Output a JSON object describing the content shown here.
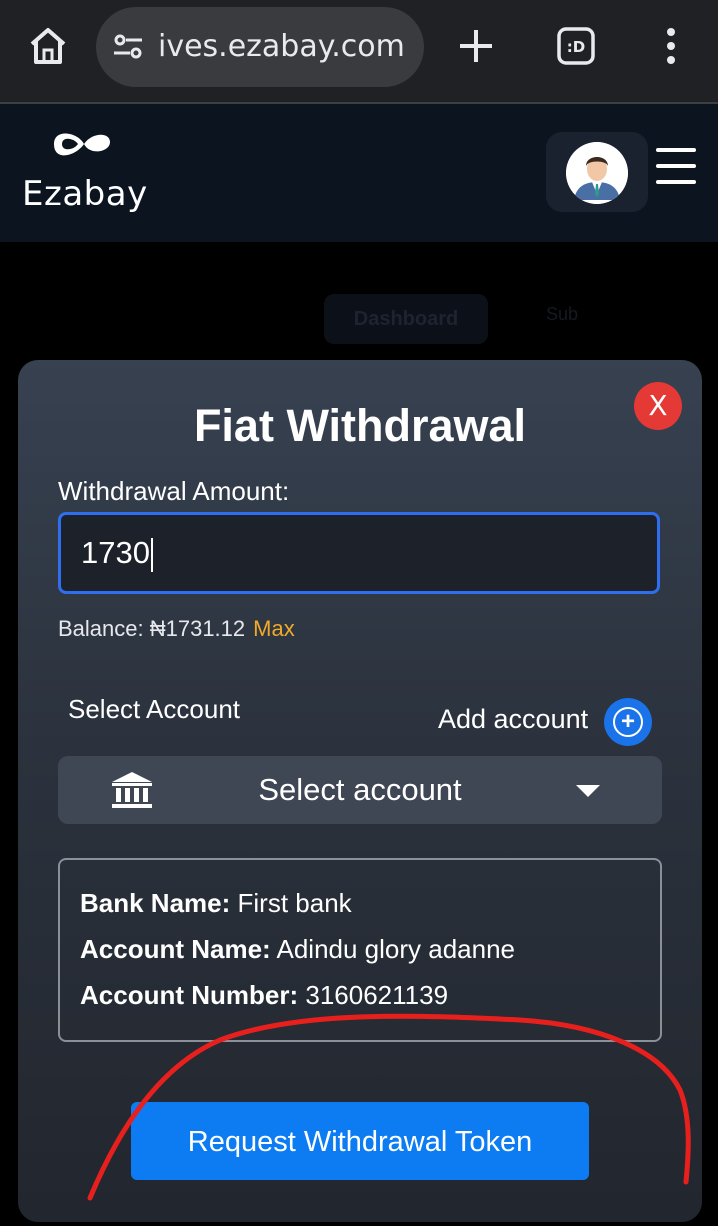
{
  "browser": {
    "url": "ives.ezabay.com",
    "tabs_count": ":D"
  },
  "site": {
    "brand": "Ezabay",
    "background_nav": {
      "dashboard": "Dashboard",
      "other": "Sub"
    }
  },
  "modal": {
    "close_label": "X",
    "title": "Fiat Withdrawal",
    "amount_label": "Withdrawal Amount:",
    "amount_value": "1730",
    "balance_text": "Balance: ₦1731.12",
    "max_label": "Max",
    "select_account_label": "Select Account",
    "add_account_label": "Add account",
    "account_select_placeholder": "Select account",
    "details": {
      "bank_name_label": "Bank Name:",
      "bank_name": "First bank",
      "account_name_label": "Account Name:",
      "account_name": "Adindu glory adanne",
      "account_number_label": "Account Number:",
      "account_number": "3160621139"
    },
    "request_button": "Request Withdrawal Token"
  },
  "colors": {
    "primary": "#0d7cf2",
    "close": "#e53935",
    "max_link": "#f0a92a",
    "annotation": "#e8201d"
  }
}
